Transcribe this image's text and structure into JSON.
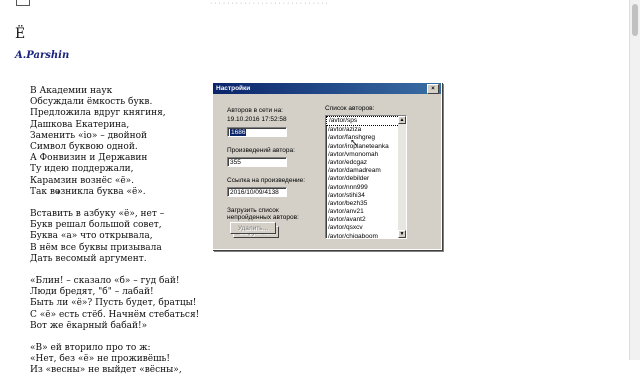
{
  "page": {
    "top_faint_text": "· · · · · · · · · · · · · · · · · · · · · · · · · · · ·",
    "big_letter": "Ё",
    "author": "A.Parshin",
    "star": "*",
    "poem": [
      [
        "В Академии наук",
        "Обсуждали ёмкость букв.",
        "Предложила вдруг княгиня,",
        "Дашкова Екатерина,",
        "Заменить «io» – двойной",
        "Символ буквою одной.",
        "А Фонвизин и Державин",
        "Ту идею поддержали,",
        "Карамзин вознёс «ё».",
        "Так возникла буква «ё»."
      ],
      [
        "Вставить в азбуку «ё», нет –",
        "Букв решал большой совет,",
        "Буква «а» что открывала,",
        "В нём все буквы призывала",
        "Дать весомый аргумент."
      ],
      [
        "«Блин! – сказало «б» – гуд бай!",
        "Люди бредят, \"б\" – лабай!",
        "Быть ли «ё»? Пусть будет, братцы!",
        "С «ё» есть стёб. Начнём стебаться!",
        "Вот же ёкарный бабай!»"
      ],
      [
        "«В» ей вторило про то ж:",
        "«Нет, без «ё» не проживёшь!",
        "Из «весны» не выйдет «вёсны»,"
      ]
    ]
  },
  "dialog": {
    "title": "Настройки",
    "close": "×",
    "authors_online_label": "Авторов в сети на:",
    "datetime": "19.10.2016 17:52:58",
    "authors_online_value": "1686",
    "works_label": "Произведений автора:",
    "works_value": "355",
    "link_label": "Ссылка на произведение:",
    "link_value": "2016/10/09/4138",
    "load_label_1": "Загрузить список",
    "load_label_2": "непройденных авторов:",
    "load_button": "Загрузить...",
    "delete_button": "Удалить...",
    "list_label": "Список авторов:",
    "authors": [
      "/avtor/sps",
      "/avtor/aziza",
      "/avtor/fanshgreg",
      "/avtor/iroplaneteanka",
      "/avtor/vmonomah",
      "/avtor/edcgaz",
      "/avtor/damadream",
      "/avtor/debilder",
      "/avtor/nnn999",
      "/avtor/stihi34",
      "/avtor/bezh35",
      "/avtor/anv21",
      "/avtor/avant2",
      "/avtor/qsxcv",
      "/avtor/chigaboom",
      "/avtor/avicenn",
      "/avtor/vladisvet",
      "/avtor/mvkuznetsova"
    ]
  }
}
